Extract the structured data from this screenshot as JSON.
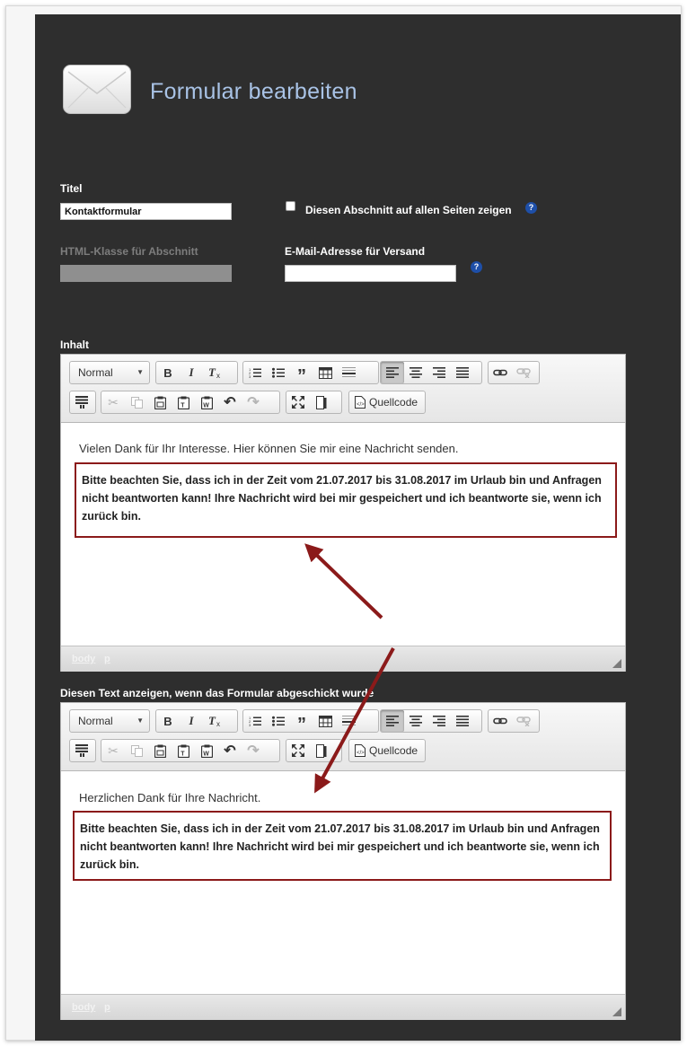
{
  "page": {
    "title": "Formular bearbeiten",
    "icon": "envelope-icon"
  },
  "form": {
    "title_label": "Titel",
    "title_value": "Kontaktformular",
    "show_all_pages_label": "Diesen Abschnitt auf allen Seiten zeigen",
    "show_all_pages_checked": false,
    "html_class_label": "HTML-Klasse für Abschnitt",
    "html_class_value": "",
    "email_label": "E-Mail-Adresse für Versand",
    "email_value": "",
    "help_glyph": "?"
  },
  "toolbar": {
    "format_value": "Normal",
    "bold": "B",
    "italic": "I",
    "source_label": "Quellcode"
  },
  "editor1": {
    "label": "Inhalt",
    "intro": "Vielen Dank für Ihr Interesse. Hier können Sie mir eine Nachricht senden.",
    "notice": "Bitte beachten Sie, dass ich in der Zeit vom 21.07.2017 bis 31.08.2017 im Urlaub bin und Anfragen nicht beantworten kann! Ihre Nachricht wird bei mir gespeichert und ich beantworte sie, wenn ich zurück bin.",
    "path_body": "body",
    "path_p": "p"
  },
  "editor2": {
    "label": "Diesen Text anzeigen, wenn das Formular abgeschickt wurde",
    "intro": "Herzlichen Dank für Ihre Nachricht.",
    "notice": "Bitte beachten Sie, dass ich in der Zeit vom 21.07.2017 bis 31.08.2017 im Urlaub bin und Anfragen nicht beantworten kann! Ihre Nachricht wird bei mir gespeichert und ich beantworte sie, wenn ich zurück bin.",
    "path_body": "body",
    "path_p": "p"
  },
  "colors": {
    "panel": "#2e2e2e",
    "title": "#a9c3e6",
    "annotation": "#8b1a1a",
    "help_badge": "#1e4fa8"
  }
}
